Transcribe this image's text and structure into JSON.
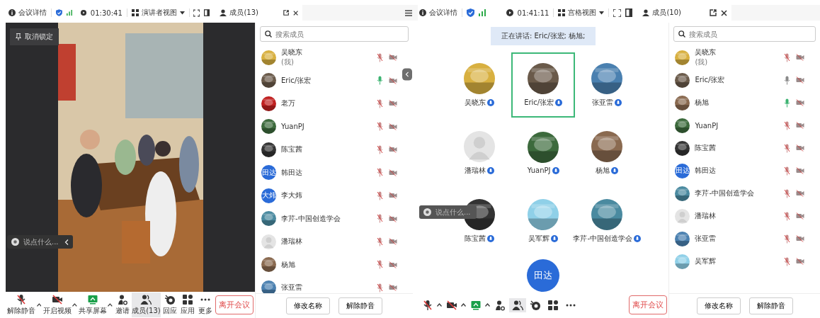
{
  "left": {
    "topbar": {
      "details": "会议详情",
      "timer": "01:30:41",
      "view": "演讲者视图",
      "members_tab": "成员(13)"
    },
    "unlock_button": "取消锁定",
    "chat": {
      "placeholder": "说点什么..."
    },
    "toolbar": [
      {
        "kind": "mic",
        "label": "解除静音",
        "caret": true,
        "selected": false
      },
      {
        "kind": "camera",
        "label": "开启视频",
        "caret": true,
        "selected": false
      },
      {
        "kind": "share",
        "label": "共享屏幕",
        "caret": true,
        "selected": false
      },
      {
        "kind": "invite",
        "label": "邀请",
        "caret": false,
        "selected": false
      },
      {
        "kind": "members",
        "label": "成员(13)",
        "caret": false,
        "selected": true
      },
      {
        "kind": "reaction",
        "label": "回应",
        "caret": false,
        "selected": false
      },
      {
        "kind": "apps",
        "label": "应用",
        "caret": false,
        "selected": false
      },
      {
        "kind": "more",
        "label": "更多",
        "caret": false,
        "selected": false
      }
    ],
    "leave_button": "离开会议",
    "members": {
      "search_placeholder": "搜索成员",
      "list": [
        {
          "name": "吴晓东",
          "note": "(我)",
          "muted": true,
          "speaking": false
        },
        {
          "name": "Eric/张宏",
          "muted": false,
          "speaking": true
        },
        {
          "name": "老万",
          "muted": true,
          "speaking": false
        },
        {
          "name": "YuanPJ",
          "muted": true,
          "speaking": false
        },
        {
          "name": "陈宝茜",
          "muted": true,
          "speaking": false
        },
        {
          "name": "韩田达",
          "avatar": {
            "kind": "text",
            "text": "田达"
          },
          "muted": true,
          "speaking": false
        },
        {
          "name": "李大炜",
          "avatar": {
            "kind": "text",
            "text": "大炜"
          },
          "muted": true,
          "speaking": false
        },
        {
          "name": "李芹-中国创造学会",
          "muted": true,
          "speaking": false
        },
        {
          "name": "潘瑞林",
          "avatar": {
            "kind": "default"
          },
          "muted": true,
          "speaking": false
        },
        {
          "name": "杨旭",
          "muted": true,
          "speaking": false
        },
        {
          "name": "张亚雷",
          "muted": true,
          "speaking": false
        }
      ],
      "buttons": [
        "修改名称",
        "解除静音"
      ]
    }
  },
  "right": {
    "topbar": {
      "details": "会议详情",
      "timer": "01:41:11",
      "view": "宫格视图",
      "members_tab": "成员(10)"
    },
    "banner": "正在讲话: Eric/张宏; 杨旭;",
    "grid": [
      {
        "name": "吴晓东",
        "highlighted": false
      },
      {
        "name": "Eric/张宏",
        "highlighted": true
      },
      {
        "name": "张亚雷",
        "highlighted": false
      },
      {
        "name": "潘瑞林",
        "avatar": {
          "kind": "default"
        },
        "highlighted": false
      },
      {
        "name": "YuanPJ",
        "highlighted": false
      },
      {
        "name": "杨旭",
        "highlighted": false
      },
      {
        "name": "陈宝茜",
        "highlighted": false
      },
      {
        "name": "吴军辉",
        "highlighted": false
      },
      {
        "name": "李芹-中国创造学会",
        "highlighted": false
      }
    ],
    "partial_tile": {
      "text": "田达"
    },
    "chat": {
      "placeholder": "说点什么..."
    },
    "toolbar": [
      {
        "kind": "mic",
        "caret": true,
        "selected": false
      },
      {
        "kind": "camera",
        "caret": true,
        "selected": false
      },
      {
        "kind": "share",
        "caret": true,
        "selected": false
      },
      {
        "kind": "invite",
        "caret": false,
        "selected": false
      },
      {
        "kind": "members",
        "caret": false,
        "selected": true
      },
      {
        "kind": "reaction",
        "caret": false,
        "selected": false
      },
      {
        "kind": "apps",
        "caret": false,
        "selected": false
      },
      {
        "kind": "more",
        "caret": false,
        "selected": false
      }
    ],
    "leave_button": "离开会议",
    "members": {
      "search_placeholder": "搜索成员",
      "list": [
        {
          "name": "吴晓东",
          "note": "(我)",
          "muted": true,
          "speaking": false
        },
        {
          "name": "Eric/张宏",
          "muted": false,
          "speaking": false
        },
        {
          "name": "杨旭",
          "muted": false,
          "speaking": true
        },
        {
          "name": "YuanPJ",
          "muted": true,
          "speaking": false
        },
        {
          "name": "陈宝茜",
          "muted": true,
          "speaking": false
        },
        {
          "name": "韩田达",
          "avatar": {
            "kind": "text",
            "text": "田达"
          },
          "muted": true,
          "speaking": false
        },
        {
          "name": "李芹-中国创造学会",
          "muted": true,
          "speaking": false
        },
        {
          "name": "潘瑞林",
          "avatar": {
            "kind": "default"
          },
          "muted": true,
          "speaking": false
        },
        {
          "name": "张亚雷",
          "muted": true,
          "speaking": false
        },
        {
          "name": "吴军辉",
          "muted": true,
          "speaking": false
        }
      ],
      "buttons": [
        "修改名称",
        "解除静音"
      ]
    }
  }
}
